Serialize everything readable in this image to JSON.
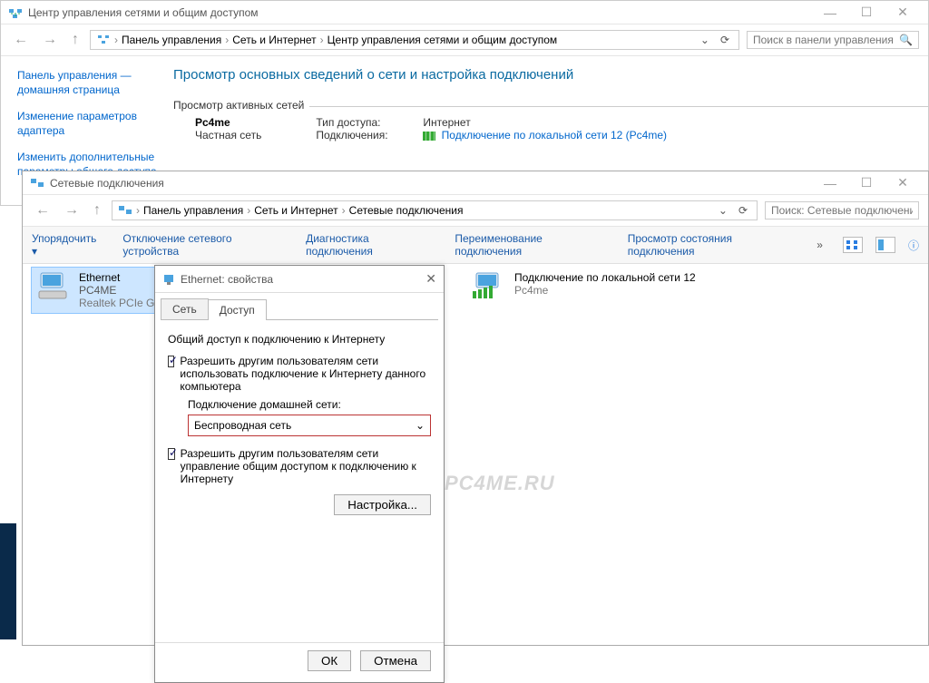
{
  "win1": {
    "title": "Центр управления сетями и общим доступом",
    "path": [
      "Панель управления",
      "Сеть и Интернет",
      "Центр управления сетями и общим доступом"
    ],
    "search_placeholder": "Поиск в панели управления",
    "sidebar": {
      "items": [
        "Панель управления — домашняя страница",
        "Изменение параметров адаптера",
        "Изменить дополнительные параметры общего доступа"
      ]
    },
    "main": {
      "heading": "Просмотр основных сведений о сети и настройка подключений",
      "active_label": "Просмотр активных сетей",
      "network": {
        "name": "Pc4me",
        "type": "Частная сеть"
      },
      "kv": {
        "access_k": "Тип доступа:",
        "access_v": "Интернет",
        "conn_k": "Подключения:",
        "conn_v": "Подключение по локальной сети 12 (Pc4me)"
      }
    }
  },
  "win2": {
    "title": "Сетевые подключения",
    "path": [
      "Панель управления",
      "Сеть и Интернет",
      "Сетевые подключения"
    ],
    "search_placeholder": "Поиск: Сетевые подключения",
    "toolbar": {
      "organize": "Упорядочить",
      "items": [
        "Отключение сетевого устройства",
        "Диагностика подключения",
        "Переименование подключения",
        "Просмотр состояния подключения"
      ],
      "more": "»"
    },
    "connections": [
      {
        "name": "Ethernet",
        "l2": "PC4ME",
        "l3": "Realtek PCIe GBE..."
      },
      {
        "name": "Подключение по локальной сети 12",
        "l2": "",
        "l3": "Pc4me"
      }
    ]
  },
  "dlg": {
    "title": "Ethernet: свойства",
    "tabs": {
      "net": "Сеть",
      "share": "Доступ"
    },
    "group": "Общий доступ к подключению к Интернету",
    "chk1": "Разрешить другим пользователям сети использовать подключение к Интернету данного компьютера",
    "home_label": "Подключение домашней сети:",
    "home_value": "Беспроводная сеть",
    "chk2": "Разрешить другим пользователям сети управление общим доступом к подключению к Интернету",
    "settings_btn": "Настройка...",
    "ok": "ОК",
    "cancel": "Отмена"
  },
  "watermark": "PC4ME.RU"
}
